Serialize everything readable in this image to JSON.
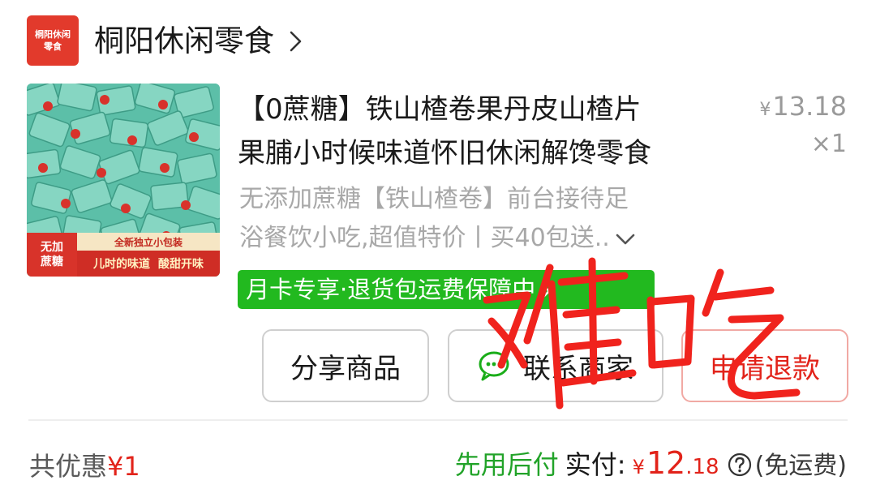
{
  "shop": {
    "logo_text_line1": "桐阳休闲",
    "logo_text_line2": "零食",
    "name": "桐阳休闲零食"
  },
  "product": {
    "image_badge_line1": "无加",
    "image_badge_line2": "蔗糖",
    "image_strip_top": "全新独立小包装",
    "image_strip_bottom_1": "儿时的味道",
    "image_strip_bottom_2": "酸甜开味",
    "title_line1": "【0蔗糖】铁山楂卷果丹皮山楂片",
    "title_line2": "果脯小时候味道怀旧休闲解馋零食",
    "price_symbol": "¥",
    "price": "13.18",
    "quantity": "×1",
    "subtitle_line1": "无添加蔗糖【铁山楂卷】前台接待足",
    "subtitle_line2": "浴餐饮小吃,超值特价丨买40包送..",
    "promo": "月卡专享·退货包运费保障中"
  },
  "actions": {
    "share": "分享商品",
    "contact": "联系商家",
    "refund": "申请退款"
  },
  "footer": {
    "discount_label": "共优惠",
    "discount_amount": "¥1",
    "pay_later": "先用后付",
    "paid_label": "实付:",
    "paid_symbol": "¥",
    "paid_integer": "12",
    "paid_decimal": ".18",
    "shipping": "(免运费)"
  },
  "overlay": {
    "handwriting": "难吃",
    "color": "#f0231d"
  },
  "colors": {
    "accent_red": "#e2231a",
    "promo_green": "#22b91f",
    "pay_later_green": "#22a329"
  }
}
